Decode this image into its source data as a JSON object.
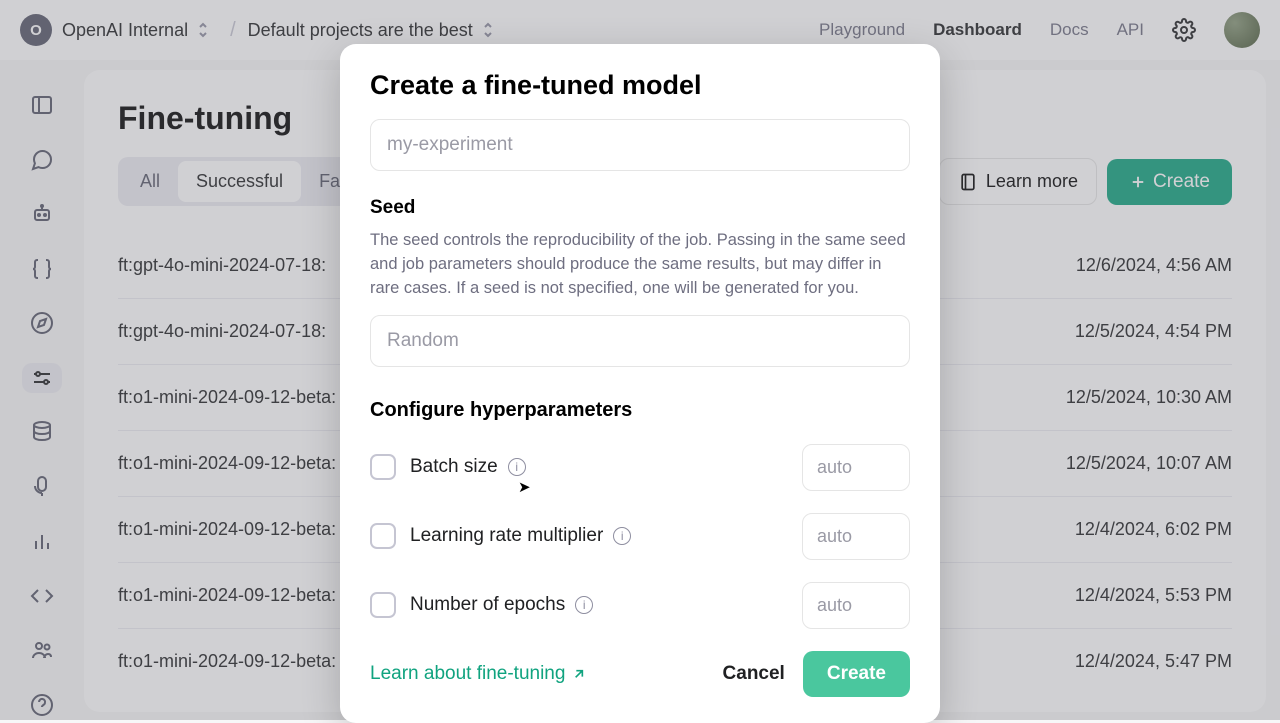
{
  "topbar": {
    "org_initial": "O",
    "org_name": "OpenAI Internal",
    "project_name": "Default projects are the best",
    "links": {
      "playground": "Playground",
      "dashboard": "Dashboard",
      "docs": "Docs",
      "api": "API"
    }
  },
  "page": {
    "title": "Fine-tuning",
    "tabs": {
      "all": "All",
      "successful": "Successful",
      "failed": "Fa"
    },
    "learn_more": "Learn more",
    "create": "Create"
  },
  "rows": [
    {
      "name": "ft:gpt-4o-mini-2024-07-18:",
      "date": "12/6/2024, 4:56 AM"
    },
    {
      "name": "ft:gpt-4o-mini-2024-07-18:",
      "date": "12/5/2024, 4:54 PM"
    },
    {
      "name": "ft:o1-mini-2024-09-12-beta:",
      "date": "12/5/2024, 10:30 AM"
    },
    {
      "name": "ft:o1-mini-2024-09-12-beta:",
      "date": "12/5/2024, 10:07 AM"
    },
    {
      "name": "ft:o1-mini-2024-09-12-beta:",
      "date": "12/4/2024, 6:02 PM"
    },
    {
      "name": "ft:o1-mini-2024-09-12-beta:",
      "date": "12/4/2024, 5:53 PM"
    },
    {
      "name": "ft:o1-mini-2024-09-12-beta:",
      "date": "12/4/2024, 5:47 PM"
    }
  ],
  "modal": {
    "title": "Create a fine-tuned model",
    "suffix_placeholder": "my-experiment",
    "seed": {
      "label": "Seed",
      "help": "The seed controls the reproducibility of the job. Passing in the same seed and job parameters should produce the same results, but may differ in rare cases. If a seed is not specified, one will be generated for you.",
      "placeholder": "Random"
    },
    "hp_title": "Configure hyperparameters",
    "hp": {
      "batch": {
        "label": "Batch size",
        "placeholder": "auto"
      },
      "lr": {
        "label": "Learning rate multiplier",
        "placeholder": "auto"
      },
      "epochs": {
        "label": "Number of epochs",
        "placeholder": "auto"
      }
    },
    "learn_link": "Learn about fine-tuning",
    "cancel": "Cancel",
    "create": "Create"
  }
}
